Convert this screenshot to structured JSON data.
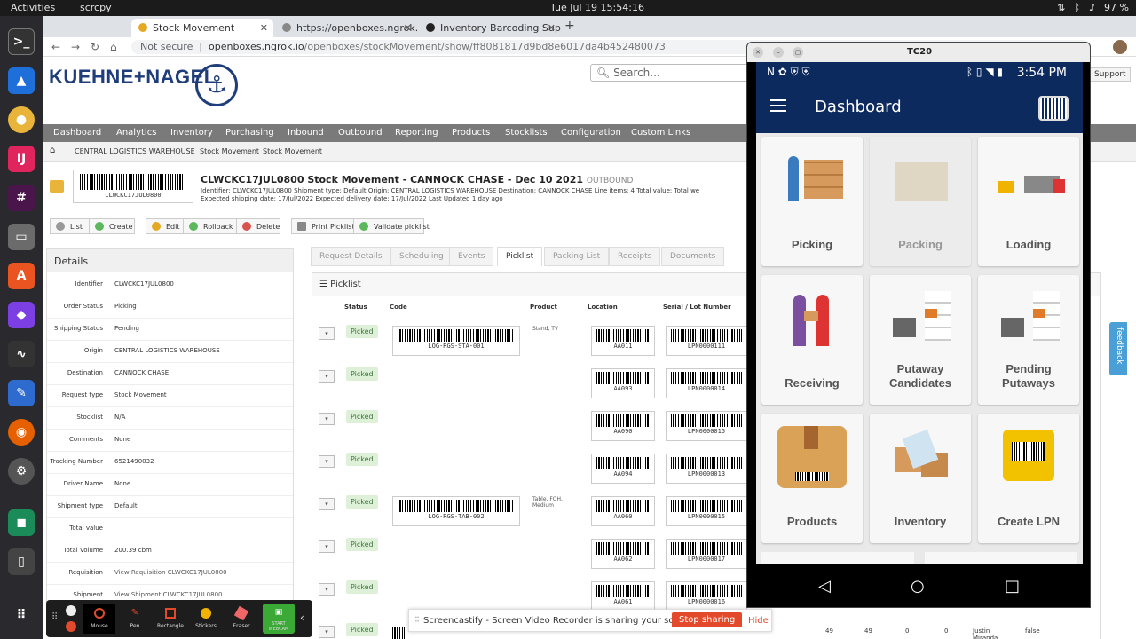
{
  "system": {
    "activities": "Activities",
    "app": "scrcpy",
    "clock": "Tue Jul 19  15:54:16",
    "battery": "97 %"
  },
  "browser": {
    "tabs": [
      {
        "label": "Stock Movement"
      },
      {
        "label": "https://openboxes.ngrok.i"
      },
      {
        "label": "Inventory Barcoding Supp"
      }
    ],
    "not_secure": "Not secure",
    "url_host": "openboxes.ngrok.io",
    "url_path": "/openboxes/stockMovement/show/ff8081817d9bd8e6017da4b452480073"
  },
  "site": {
    "logo": "KUEHNE+NAGEL",
    "search_placeholder": "Search...",
    "support": "Support",
    "nav": [
      "Dashboard",
      "Analytics",
      "Inventory",
      "Purchasing",
      "Inbound",
      "Outbound",
      "Reporting",
      "Products",
      "Stocklists",
      "Configuration",
      "Custom Links"
    ],
    "crumbs": [
      "CENTRAL LOGISTICS WAREHOUSE",
      "Stock Movement",
      "Stock Movement"
    ]
  },
  "shipment": {
    "barcode_text": "CLWCKC17JUL0800",
    "title": "CLWCKC17JUL0800 Stock Movement - CANNOCK CHASE - Dec 10 2021",
    "status": "OUTBOUND",
    "meta1": "Identifier: CLWCKC17JUL0800    Shipment type: Default    Origin: CENTRAL LOGISTICS WAREHOUSE    Destination: CANNOCK CHASE    Line items: 4    Total value:         Total we",
    "meta2": "Expected shipping date: 17/Jul/2022    Expected delivery date: 17/Jul/2022    Last Updated 1 day ago"
  },
  "actions": {
    "list": "List",
    "create": "Create",
    "edit": "Edit",
    "rollback": "Rollback",
    "delete": "Delete",
    "print": "Print Picklist",
    "validate": "Validate picklist"
  },
  "details": {
    "heading": "Details",
    "rows": [
      {
        "k": "Identifier",
        "v": "CLWCKC17JUL0800"
      },
      {
        "k": "Order Status",
        "v": "Picking"
      },
      {
        "k": "Shipping Status",
        "v": "Pending"
      },
      {
        "k": "Origin",
        "v": "CENTRAL LOGISTICS WAREHOUSE"
      },
      {
        "k": "Destination",
        "v": "CANNOCK CHASE"
      },
      {
        "k": "Request type",
        "v": "Stock Movement"
      },
      {
        "k": "Stocklist",
        "v": "N/A"
      },
      {
        "k": "Comments",
        "v": "None"
      },
      {
        "k": "Tracking Number",
        "v": "6521490032"
      },
      {
        "k": "Driver Name",
        "v": "None"
      },
      {
        "k": "Shipment type",
        "v": "Default"
      },
      {
        "k": "Total value",
        "v": ""
      },
      {
        "k": "Total Volume",
        "v": "200.39 cbm"
      },
      {
        "k": "Requisition",
        "v": "View Requisition CLWCKC17JUL0800"
      },
      {
        "k": "Shipment",
        "v": "View Shipment CLWCKC17JUL0800"
      }
    ]
  },
  "ptabs": [
    "Request Details",
    "Scheduling",
    "Events",
    "Picklist",
    "Packing List",
    "Receipts",
    "Documents"
  ],
  "picklist": {
    "heading": "Picklist",
    "cols": [
      "Status",
      "Code",
      "Product",
      "Location",
      "Serial / Lot Number"
    ],
    "rows": [
      {
        "status": "Picked",
        "code": "LOG-RGS-STA-001",
        "product": "Stand, TV",
        "loc": "AA011",
        "lot": "LPN0000111"
      },
      {
        "status": "Picked",
        "code": "",
        "product": "",
        "loc": "AA093",
        "lot": "LPN0000014"
      },
      {
        "status": "Picked",
        "code": "",
        "product": "",
        "loc": "AA090",
        "lot": "LPN0000015"
      },
      {
        "status": "Picked",
        "code": "",
        "product": "",
        "loc": "AA094",
        "lot": "LPN0000013"
      },
      {
        "status": "Picked",
        "code": "LOG-RGS-TAB-002",
        "product": "Table, FOH, Medium",
        "loc": "AA060",
        "lot": "LPN0000015"
      },
      {
        "status": "Picked",
        "code": "",
        "product": "",
        "loc": "AA062",
        "lot": "LPN0000017"
      },
      {
        "status": "Picked",
        "code": "",
        "product": "",
        "loc": "AA061",
        "lot": "LPN0000016"
      },
      {
        "status": "Picked",
        "code": "",
        "product": "",
        "loc": "",
        "lot": ""
      }
    ],
    "last_row_right": {
      "a": "49",
      "b": "49",
      "c": "0",
      "d": "0",
      "user": "Justin Miranda",
      "flag": "false"
    }
  },
  "overlay_tools": [
    "Mouse",
    "Pen",
    "Rectangle",
    "Stickers",
    "Eraser",
    "START WEBCAM"
  ],
  "share": {
    "text": "Screencastify - Screen Video Recorder is sharing your screen.",
    "stop": "Stop sharing",
    "hide": "Hide"
  },
  "feedback": "feedback",
  "scrcpy": {
    "title": "TC20",
    "time": "3:54 PM",
    "header": "Dashboard",
    "cards": [
      "Picking",
      "Packing",
      "Loading",
      "Receiving",
      "Putaway Candidates",
      "Pending Putaways",
      "Products",
      "Inventory",
      "Create LPN"
    ]
  }
}
